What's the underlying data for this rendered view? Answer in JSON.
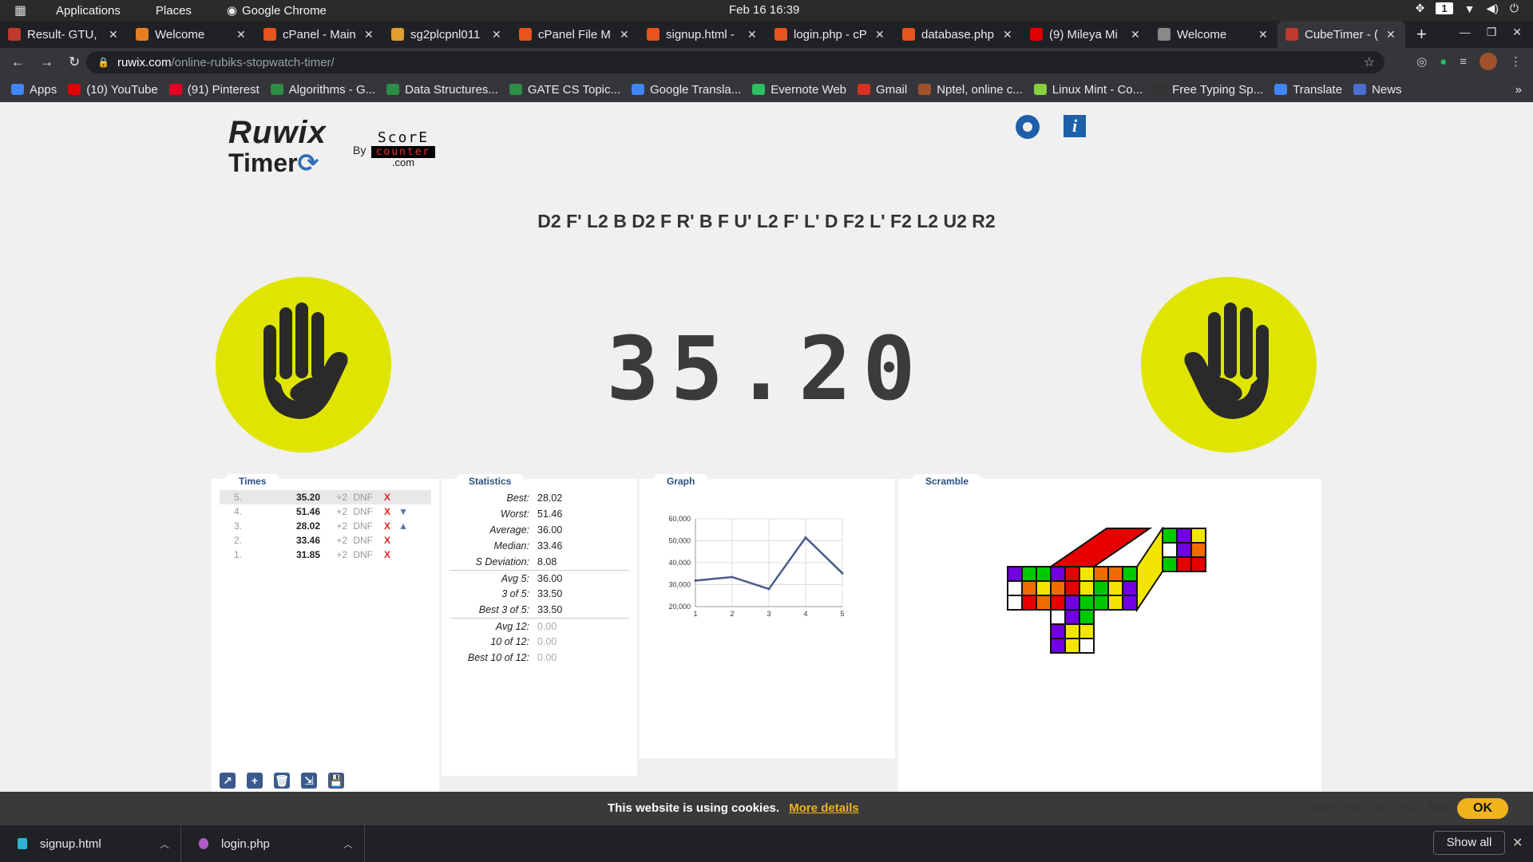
{
  "system": {
    "applications": "Applications",
    "places": "Places",
    "chrome": "Google Chrome",
    "clock": "Feb 16  16:39",
    "workspace": "1"
  },
  "tabs": [
    {
      "title": "Result- GTU, ",
      "color": "#c0392b"
    },
    {
      "title": "Welcome",
      "color": "#e67e22"
    },
    {
      "title": "cPanel - Main",
      "color": "#e8541e"
    },
    {
      "title": "sg2plcpnl011",
      "color": "#e0a030"
    },
    {
      "title": "cPanel File M",
      "color": "#e8541e"
    },
    {
      "title": "signup.html -",
      "color": "#e8541e"
    },
    {
      "title": "login.php - cP",
      "color": "#e8541e"
    },
    {
      "title": "database.php",
      "color": "#e8541e"
    },
    {
      "title": "(9) Mileya Mi",
      "color": "#e00000"
    },
    {
      "title": "Welcome",
      "color": "#888888"
    },
    {
      "title": "CubeTimer - (",
      "color": "#c0392b"
    }
  ],
  "url": {
    "host": "ruwix.com",
    "path": "/online-rubiks-stopwatch-timer/"
  },
  "bookmarks": [
    {
      "label": "Apps",
      "color": "#4285f4"
    },
    {
      "label": "(10) YouTube",
      "color": "#e00000"
    },
    {
      "label": "(91) Pinterest",
      "color": "#e60023"
    },
    {
      "label": "Algorithms - G...",
      "color": "#2f8d46"
    },
    {
      "label": "Data Structures...",
      "color": "#2f8d46"
    },
    {
      "label": "GATE CS Topic...",
      "color": "#2f8d46"
    },
    {
      "label": "Google Transla...",
      "color": "#4285f4"
    },
    {
      "label": "Evernote Web",
      "color": "#2dbe60"
    },
    {
      "label": "Gmail",
      "color": "#d93025"
    },
    {
      "label": "Nptel, online c...",
      "color": "#a0522d"
    },
    {
      "label": "Linux Mint - Co...",
      "color": "#87cf3e"
    },
    {
      "label": "Free Typing Sp...",
      "color": "#333333"
    },
    {
      "label": "Translate",
      "color": "#4285f4"
    },
    {
      "label": "News",
      "color": "#4a6fd0"
    }
  ],
  "page": {
    "logo_ruwix": "Ruwix",
    "logo_timer": "Timer",
    "by": "By",
    "score_top": "ScorE",
    "score_mid": "counter",
    "score_bottom": ".com",
    "scramble": "D2 F' L2 B D2 F R' B F U' L2 F' L' D F2 L' F2 L2 U2 R2",
    "timer": "35.20",
    "accent": "#dfe500"
  },
  "times": {
    "title": "Times",
    "plus2": "+2",
    "dnf": "DNF",
    "delete": "X",
    "rows": [
      {
        "num": "5.",
        "value": "35.20",
        "thumb": ""
      },
      {
        "num": "4.",
        "value": "51.46",
        "thumb": "▼"
      },
      {
        "num": "3.",
        "value": "28.02",
        "thumb": "▲"
      },
      {
        "num": "2.",
        "value": "33.46",
        "thumb": ""
      },
      {
        "num": "1.",
        "value": "31.85",
        "thumb": ""
      }
    ]
  },
  "statistics": {
    "title": "Statistics",
    "rows": [
      {
        "label": "Best:",
        "value": "28.02"
      },
      {
        "label": "Worst:",
        "value": "51.46"
      },
      {
        "label": "Average:",
        "value": "36.00"
      },
      {
        "label": "Median:",
        "value": "33.46"
      },
      {
        "label": "S Deviation:",
        "value": "8.08"
      },
      {
        "label": "Avg 5:",
        "value": "36.00"
      },
      {
        "label": "3 of 5:",
        "value": "33.50"
      },
      {
        "label": "Best 3 of 5:",
        "value": "33.50"
      },
      {
        "label": "Avg 12:",
        "value": "0.00"
      },
      {
        "label": "10 of 12:",
        "value": "0.00"
      },
      {
        "label": "Best 10 of 12:",
        "value": "0.00"
      }
    ]
  },
  "graph": {
    "title": "Graph"
  },
  "chart_data": {
    "type": "line",
    "x": [
      1,
      2,
      3,
      4,
      5
    ],
    "series": [
      {
        "values": [
          31850,
          33460,
          28020,
          51460,
          35200
        ]
      }
    ],
    "ylim": [
      20000,
      60000
    ],
    "yticks": [
      "60,000",
      "50,000",
      "40,000",
      "30,000",
      "20,000"
    ],
    "xticks": [
      "1",
      "2",
      "3",
      "4",
      "5"
    ],
    "color": "#4a5a8c",
    "grid": true
  },
  "scramble_panel": {
    "title": "Scramble"
  },
  "cookie": {
    "message": "This website is using cookies.",
    "more": "More details",
    "methods": [
      "CFOP",
      "F2L",
      "OLL",
      "PLL",
      "Solv"
    ],
    "ok": "OK"
  },
  "downloads": {
    "items": [
      "signup.html",
      "login.php"
    ],
    "show_all": "Show all"
  }
}
